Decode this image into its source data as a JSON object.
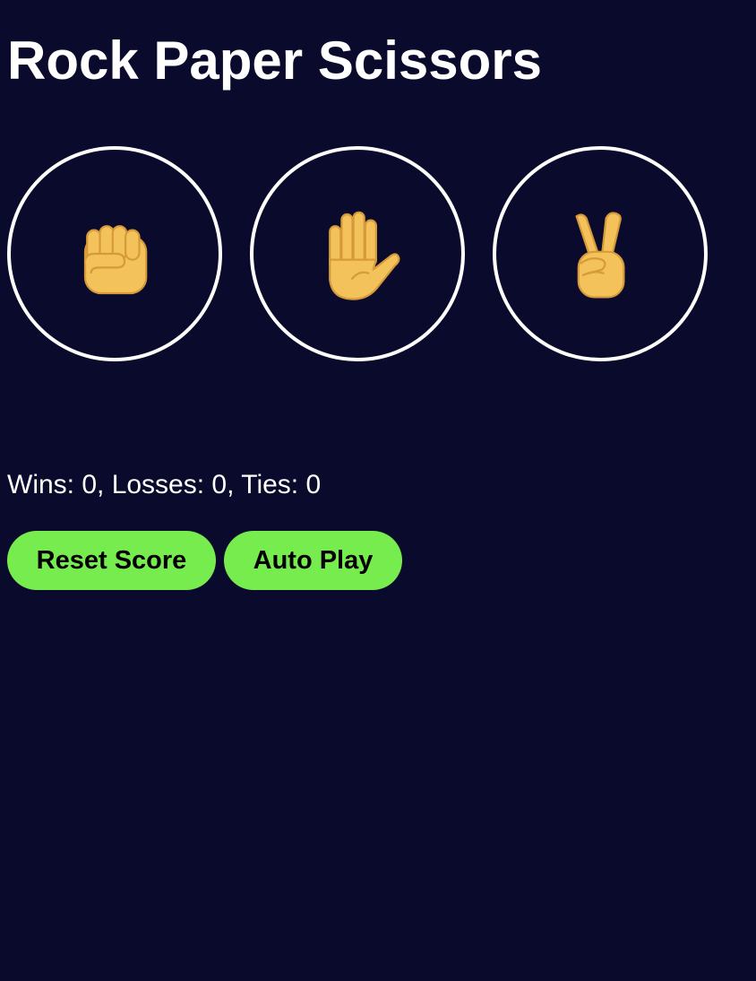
{
  "title": "Rock Paper Scissors",
  "moves": [
    {
      "name": "rock",
      "icon": "raised-fist-icon"
    },
    {
      "name": "paper",
      "icon": "raised-hand-icon"
    },
    {
      "name": "scissors",
      "icon": "victory-hand-icon"
    }
  ],
  "score": {
    "text": "Wins: 0, Losses: 0, Ties: 0"
  },
  "actions": {
    "reset_label": "Reset Score",
    "autoplay_label": "Auto Play"
  },
  "colors": {
    "background": "#0a0a2c",
    "text": "#ffffff",
    "button_green": "#77ec4f",
    "hand_skin": "#f3c25a",
    "hand_line": "#d69a3a"
  }
}
